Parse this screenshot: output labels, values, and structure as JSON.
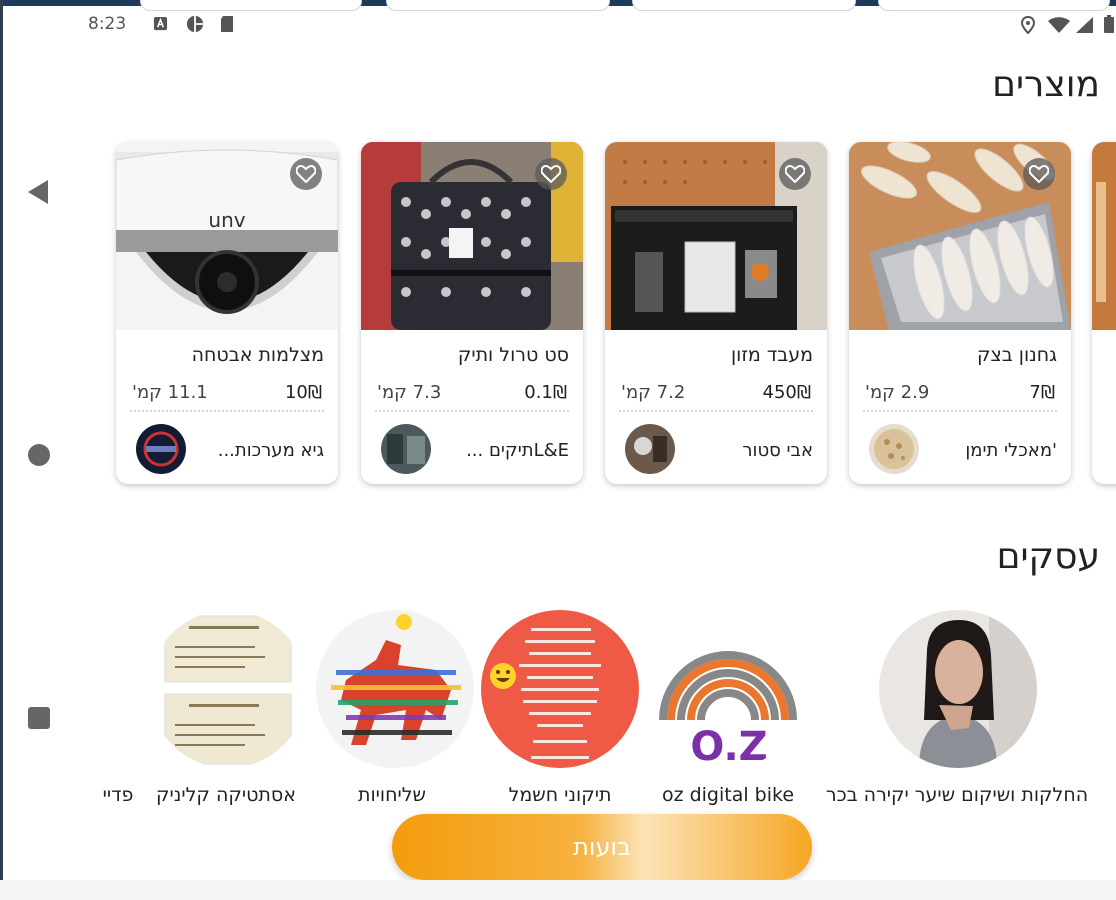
{
  "status_bar": {
    "time": "8:23",
    "left_icons": [
      "a-icon",
      "media-icon",
      "sd-card-icon"
    ],
    "right_icons": [
      "location-icon",
      "wifi-icon",
      "signal-icon",
      "battery-icon"
    ]
  },
  "products_section": {
    "title": "מוצרים",
    "items": [
      {
        "title": "מצלמות אבטחה",
        "price": "10₪",
        "distance": "11.1 קמ'",
        "seller": "גיא מערכות...",
        "image": "security-camera"
      },
      {
        "title": "סט טרול ותיק",
        "price": "0.1₪",
        "distance": "7.3 קמ'",
        "seller": "L&Eתיקים ...",
        "image": "luggage-set"
      },
      {
        "title": "מעבד מזון",
        "price": "450₪",
        "distance": "7.2 קמ'",
        "seller": "אבי סטור",
        "image": "food-processor"
      },
      {
        "title": "גחנון בצק",
        "price": "7₪",
        "distance": "2.9 קמ'",
        "seller": "'מאכלי תימן",
        "image": "dough-rolls"
      }
    ]
  },
  "businesses_section": {
    "title": "עסקים",
    "items": [
      {
        "label": "החלקות ושיקום שיער יקירה בכר",
        "image": "woman-portrait"
      },
      {
        "label": "oz digital bike",
        "image": "oz-logo",
        "logo_text": "O.Z"
      },
      {
        "label": "תיקוני חשמל",
        "image": "electrician-flyer"
      },
      {
        "label": "שליחויות",
        "image": "horse-art"
      },
      {
        "label": "אסתטיקה קליניק",
        "image": "business-cards"
      },
      {
        "label": "פדיי",
        "image": "partial"
      }
    ]
  },
  "cta": {
    "label": "בועות"
  },
  "colors": {
    "accent": "#f39c0c",
    "nav": "#666666",
    "frame": "#1f3a5c"
  }
}
